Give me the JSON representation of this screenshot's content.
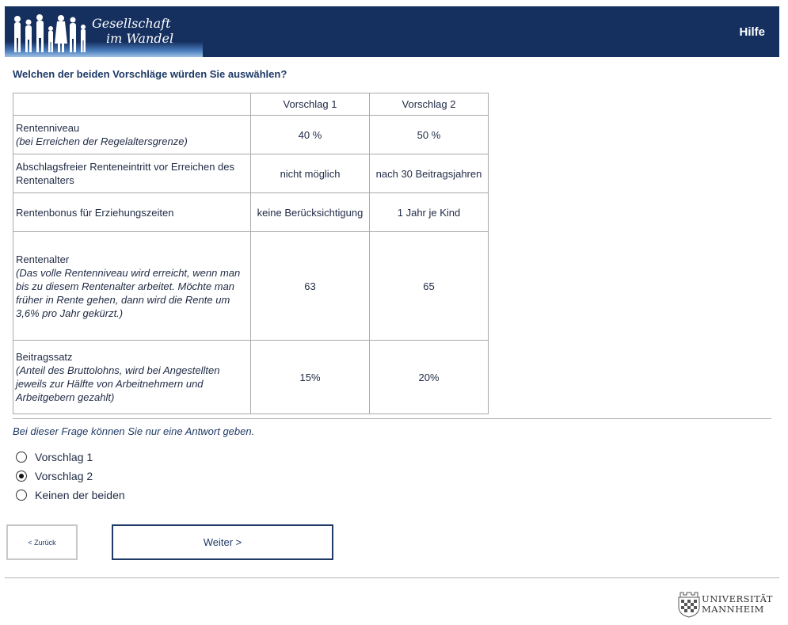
{
  "header": {
    "logo_line1": "Gesellschaft",
    "logo_line2": "im Wandel",
    "help_label": "Hilfe",
    "bg_color": "#15305f"
  },
  "question": "Welchen der beiden Vorschläge würden Sie auswählen?",
  "table": {
    "headers": [
      "",
      "Vorschlag 1",
      "Vorschlag 2"
    ],
    "rows": [
      {
        "label": "Rentenniveau",
        "note": "(bei Erreichen der Regelaltersgrenze)",
        "v1": "40 %",
        "v2": "50 %"
      },
      {
        "label": "Abschlagsfreier Renteneintritt vor Erreichen des Rentenalters",
        "note": "",
        "v1": "nicht möglich",
        "v2": "nach 30 Beitragsjahren"
      },
      {
        "label": "Rentenbonus für Erziehungszeiten",
        "note": "",
        "v1": "keine Berücksichtigung",
        "v2": "1 Jahr je Kind"
      },
      {
        "label": "Rentenalter",
        "note": "(Das volle Rentenniveau wird erreicht, wenn man bis zu diesem Rentenalter arbeitet. Möchte man früher in Rente gehen, dann wird die Rente um 3,6% pro Jahr gekürzt.)",
        "v1": "63",
        "v2": "65"
      },
      {
        "label": "Beitragssatz",
        "note": "(Anteil des Bruttolohns, wird bei Angestellten jeweils zur Hälfte von Arbeitnehmern und Arbeitgebern gezahlt)",
        "v1": "15%",
        "v2": "20%"
      }
    ]
  },
  "hint": "Bei dieser Frage können Sie nur eine Antwort geben.",
  "options": [
    {
      "label": "Vorschlag 1",
      "checked": false
    },
    {
      "label": "Vorschlag 2",
      "checked": true
    },
    {
      "label": "Keinen der beiden",
      "checked": false
    }
  ],
  "buttons": {
    "back_label": "< Zurück",
    "next_label": "Weiter >"
  },
  "footer": {
    "uni_line1": "UNIVERSITÄT",
    "uni_line2": "MANNHEIM"
  }
}
